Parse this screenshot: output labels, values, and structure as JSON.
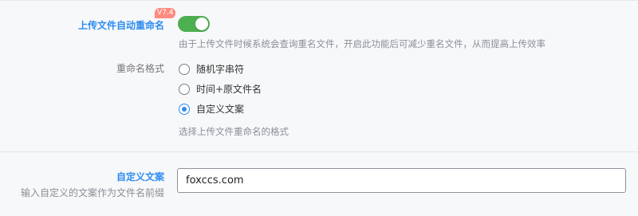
{
  "rename": {
    "label": "上传文件自动重命名",
    "badge": "V7.4",
    "enabled": true,
    "help": "由于上传文件时候系统会查询重名文件，开启此功能后可减少重名文件，从而提高上传效率"
  },
  "format": {
    "label": "重命名格式",
    "options": [
      {
        "label": "随机字串符",
        "checked": false
      },
      {
        "label": "时间+原文件名",
        "checked": false
      },
      {
        "label": "自定义文案",
        "checked": true
      }
    ],
    "help": "选择上传文件重命名的格式"
  },
  "custom_text": {
    "label": "自定义文案",
    "sublabel": "输入自定义的文案作为文件名前缀",
    "value": "foxccs.com"
  },
  "colors": {
    "accent": "#2d8cf0",
    "switch_on": "#4caf50",
    "badge": "#ff8a80"
  }
}
